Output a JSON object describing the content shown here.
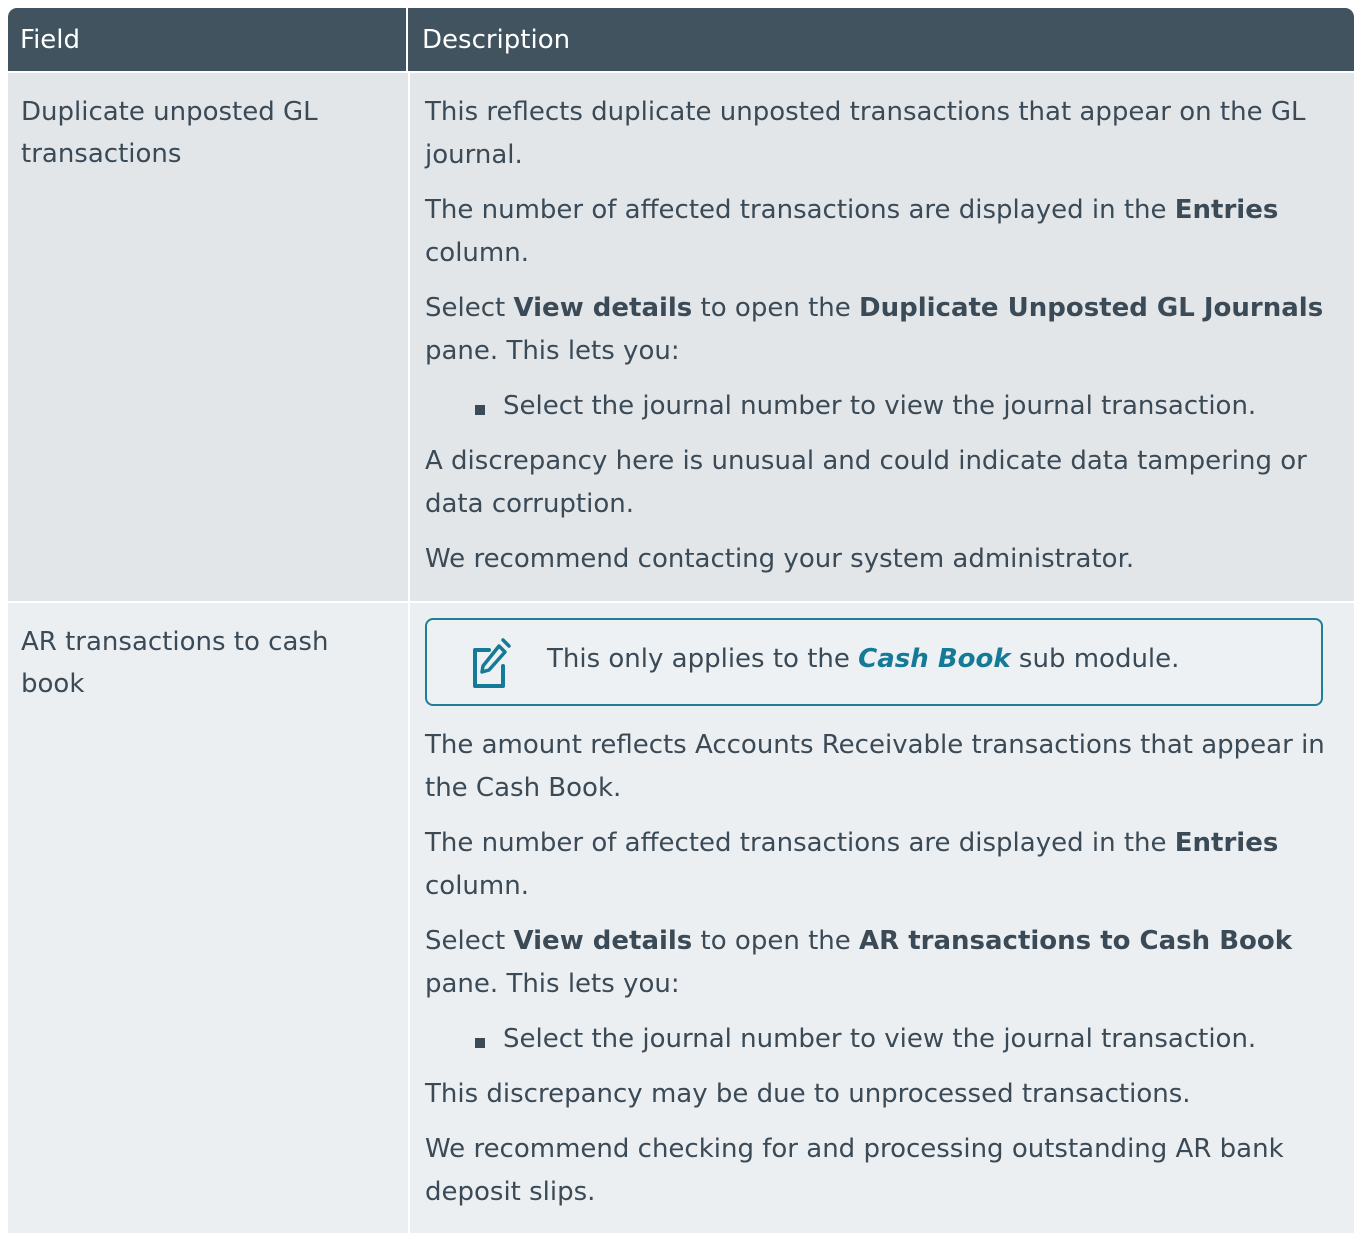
{
  "header": {
    "field": "Field",
    "description": "Description"
  },
  "rows": [
    {
      "field": "Duplicate unposted GL transactions",
      "desc": {
        "p1": "This reflects duplicate unposted transactions that appear on the GL journal.",
        "p2_pre": "The number of affected transactions are displayed in the ",
        "p2_bold": "Entries",
        "p2_post": " column.",
        "p3_pre": "Select ",
        "p3_bold1": "View details",
        "p3_mid": " to open the ",
        "p3_bold2": "Duplicate Unposted GL Journals",
        "p3_post": " pane. This lets you:",
        "bullet": "Select the journal number to view the journal transaction.",
        "p4": "A discrepancy here is unusual and could indicate data tampering or data corruption.",
        "p5": "We recommend contacting your system administrator."
      }
    },
    {
      "field": "AR transactions to cash book",
      "note": {
        "pre": "This only applies to the ",
        "link": "Cash Book",
        "post": " sub module."
      },
      "desc": {
        "p1": "The amount reflects Accounts Receivable transactions that appear in the Cash Book.",
        "p2_pre": "The number of affected transactions are displayed in the ",
        "p2_bold": "Entries",
        "p2_post": " column.",
        "p3_pre": "Select ",
        "p3_bold1": "View details",
        "p3_mid": " to open the ",
        "p3_bold2": "AR transactions to Cash Book",
        "p3_post": " pane. This lets you:",
        "bullet": "Select the journal number to view the journal transaction.",
        "p4": "This discrepancy may be due to unprocessed transactions.",
        "p5": "We recommend checking for and processing outstanding AR bank deposit slips."
      }
    }
  ],
  "colors": {
    "header_bg": "#40535f",
    "row1_bg": "#e2e6e9",
    "row2_bg": "#eceff1",
    "text": "#3b4a57",
    "accent": "#157a97"
  },
  "icons": {
    "note": "note-pencil-icon"
  }
}
